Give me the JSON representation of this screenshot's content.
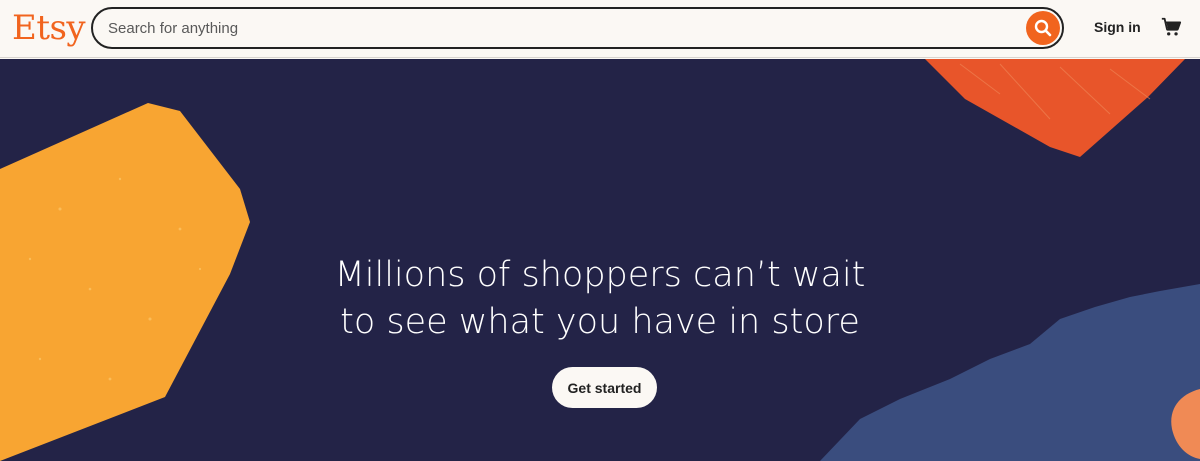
{
  "header": {
    "logo": "Etsy",
    "search_placeholder": "Search for anything",
    "sign_in": "Sign in",
    "icons": [
      "search-icon",
      "cart-icon"
    ]
  },
  "hero": {
    "headline_line1": "Millions of shoppers can’t wait",
    "headline_line2": "to see what you have in store",
    "cta_label": "Get started"
  },
  "colors": {
    "brand_orange": "#f1641e",
    "hero_bg": "#232347",
    "shape_yellow": "#f8a532",
    "shape_red": "#e8552a",
    "shape_blue": "#3a4d7e",
    "page_bg": "#fbf8f4"
  }
}
